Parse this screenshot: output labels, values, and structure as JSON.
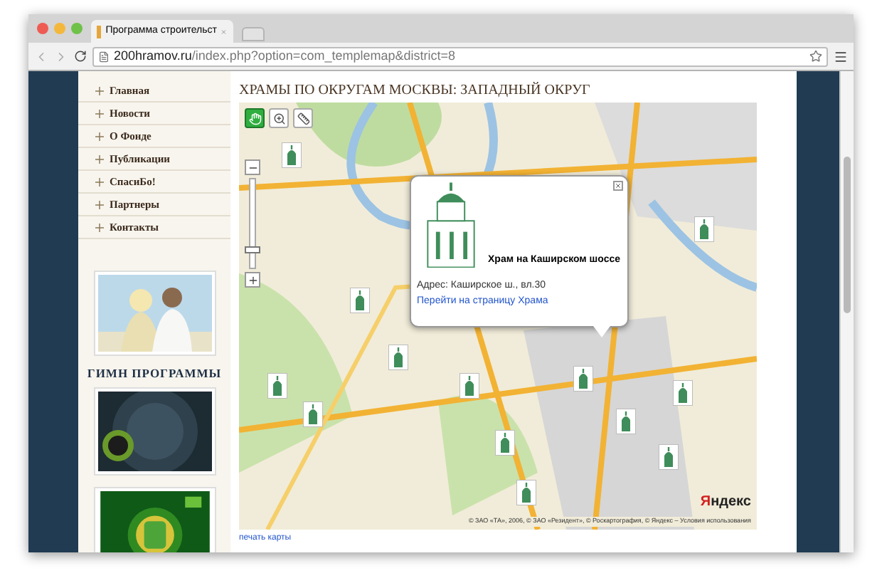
{
  "browser": {
    "tab": {
      "title": "Программа строительст"
    },
    "address": {
      "domain": "200hramov.ru",
      "path": "/index.php?option=com_templemap&district=8"
    }
  },
  "sidebar": {
    "menu": [
      {
        "label": "Главная"
      },
      {
        "label": "Новости"
      },
      {
        "label": "О Фонде"
      },
      {
        "label": "Публикации"
      },
      {
        "label": "СпасиБо!"
      },
      {
        "label": "Партнеры"
      },
      {
        "label": "Контакты"
      }
    ],
    "anthem_heading": "ГИМН ПРОГРАММЫ",
    "banners": [
      {
        "kind": "people"
      },
      {
        "kind": "tv"
      },
      {
        "kind": "green"
      }
    ]
  },
  "page": {
    "title": "ХРАМЫ ПО ОКРУГАМ МОСКВЫ: ЗАПАДНЫЙ ОКРУГ"
  },
  "map": {
    "tools": [
      {
        "kind": "hand",
        "selected": true
      },
      {
        "kind": "zoom",
        "selected": false
      },
      {
        "kind": "ruler",
        "selected": false
      }
    ],
    "popup": {
      "name": "Храм на Каширском шоссе",
      "address": "Адрес: Каширское ш., вл.30",
      "link": "Перейти на страницу Храма"
    },
    "zoom": {
      "level": 0.2
    },
    "logo": "Яндекс",
    "copyright": "© ЗАО «ТА», 2006, © ЗАО «Резидент», © Роскартография, © Яндекс – Условия использования",
    "print_link": "печать карты"
  }
}
